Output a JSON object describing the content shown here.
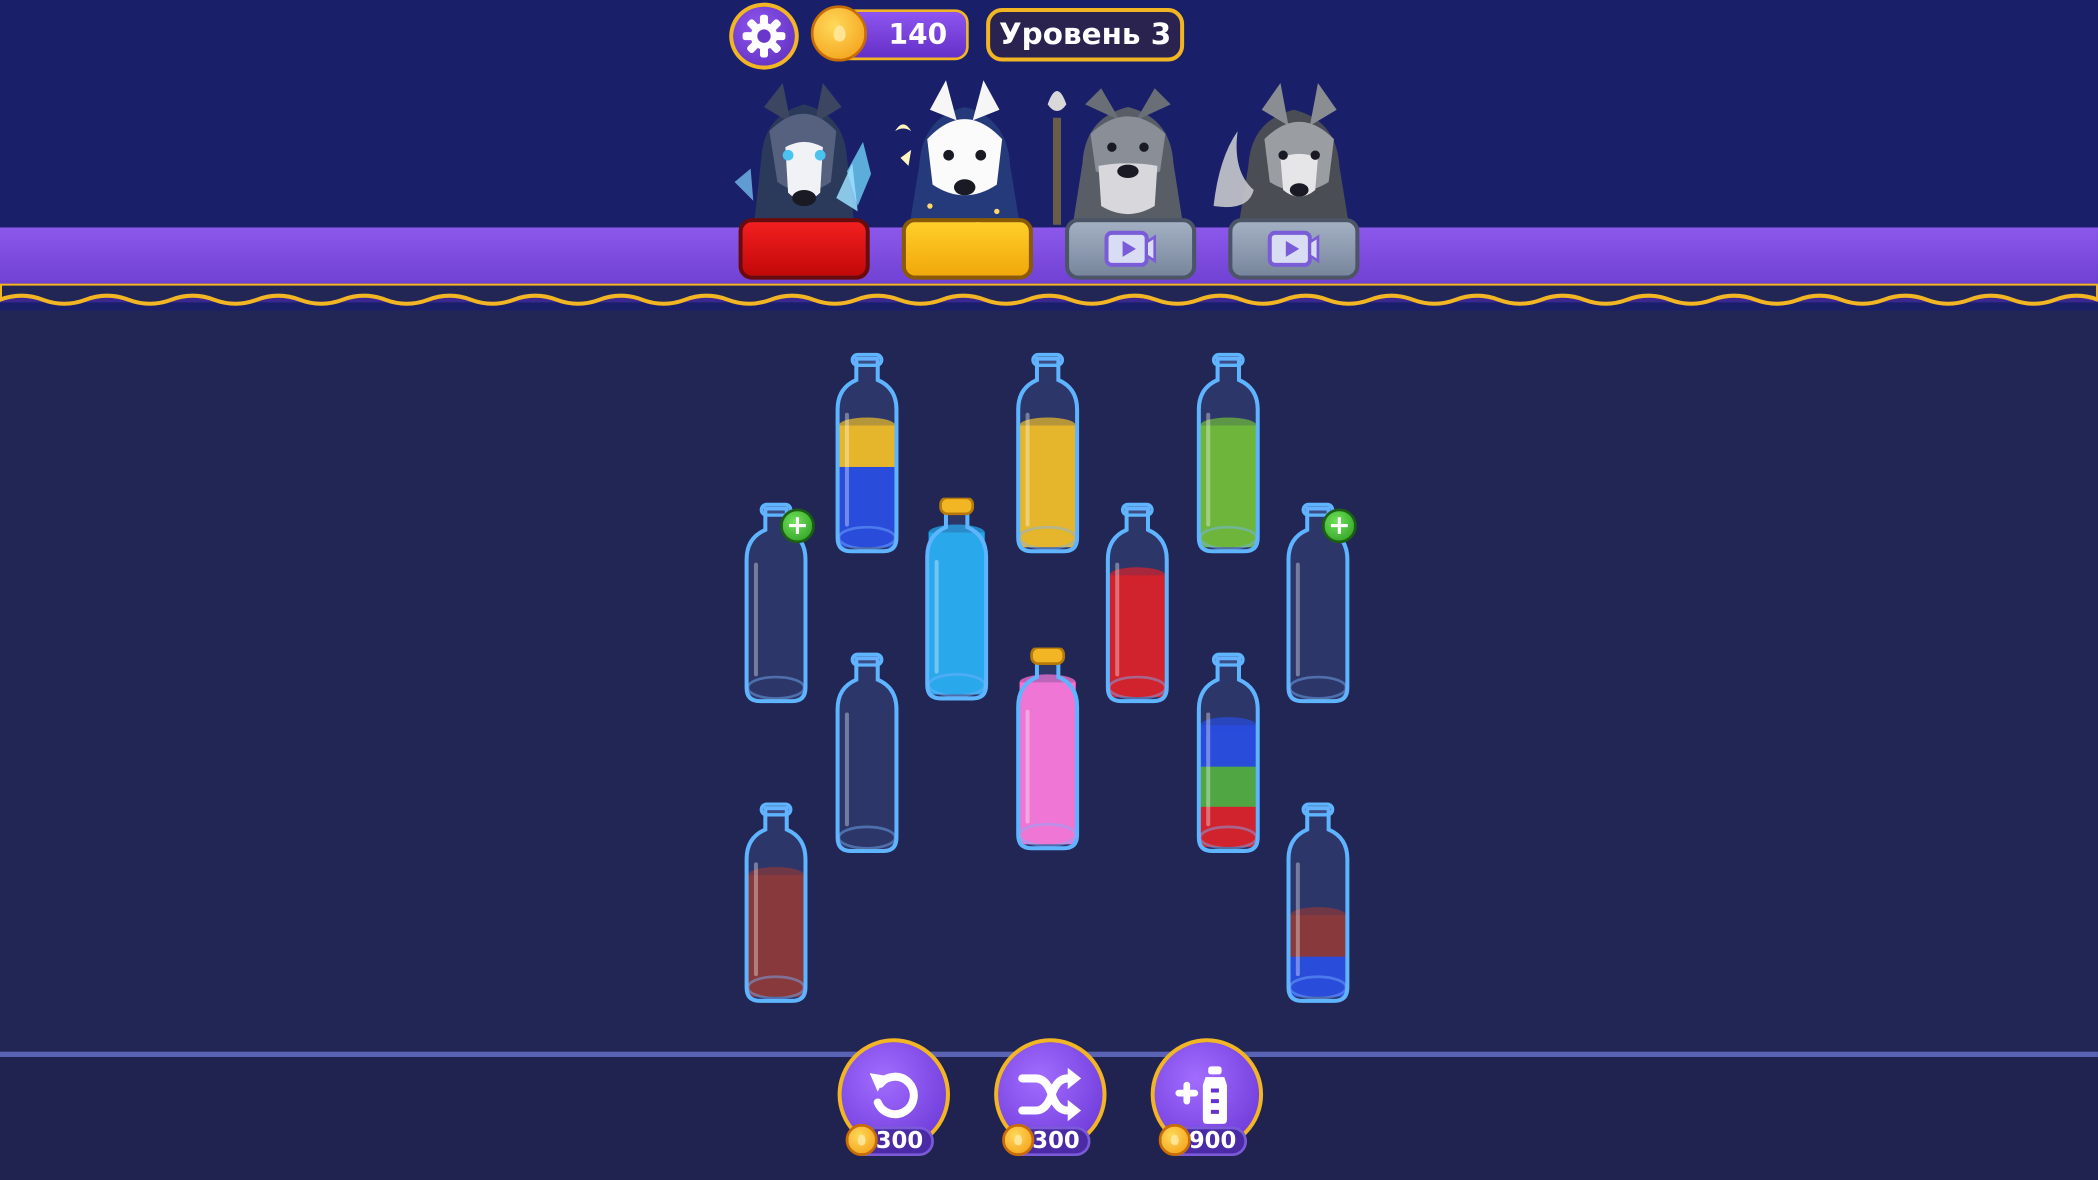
{
  "hud": {
    "coins": "140",
    "level": "Уровень 3",
    "settings_icon": "gear-icon",
    "coin_icon": "coin-drop-icon"
  },
  "characters": [
    {
      "name": "husky",
      "pedestal_color": "#e01414",
      "pedestal": "red",
      "locked": false
    },
    {
      "name": "samoyed",
      "pedestal_color": "#f7bb18",
      "pedestal": "yellow",
      "locked": false
    },
    {
      "name": "schnauzer",
      "pedestal": "gray",
      "locked": true,
      "icon": "video-play-icon"
    },
    {
      "name": "shiba",
      "pedestal": "gray",
      "locked": true,
      "icon": "video-play-icon"
    }
  ],
  "bottles": [
    {
      "id": "b1",
      "layers": [
        "#1e3fd6",
        "#1e3fd6",
        "#f4b80f"
      ],
      "capped": false
    },
    {
      "id": "b2",
      "layers": [
        "#f4b80f",
        "#f4b80f",
        "#f4b80f"
      ],
      "capped": false
    },
    {
      "id": "b3",
      "layers": [
        "#6bb820",
        "#6bb820",
        "#6bb820"
      ],
      "capped": false
    },
    {
      "id": "b4",
      "layers": [],
      "capped": false,
      "add_badge": true
    },
    {
      "id": "b5",
      "layers": [
        "#1fa8ea",
        "#1fa8ea",
        "#1fa8ea",
        "#1fa8ea"
      ],
      "capped": true
    },
    {
      "id": "b6",
      "layers": [
        "#dd1010",
        "#dd1010",
        "#dd1010"
      ],
      "capped": false
    },
    {
      "id": "b7",
      "layers": [],
      "capped": false,
      "add_badge": true
    },
    {
      "id": "b8",
      "layers": [],
      "capped": false
    },
    {
      "id": "b9",
      "layers": [
        "#ff6fd0",
        "#ff6fd0",
        "#ff6fd0",
        "#ff6fd0"
      ],
      "capped": true
    },
    {
      "id": "b10",
      "layers": [
        "#dd1010",
        "#4aa52a",
        "#1e3fd6"
      ],
      "capped": false
    },
    {
      "id": "b11",
      "layers": [
        "#8a2a22",
        "#8a2a22",
        "#8a2a22"
      ],
      "capped": false
    },
    {
      "id": "b12",
      "layers": [
        "#1e3fd6",
        "#8a2a22"
      ],
      "capped": false
    }
  ],
  "powerups": [
    {
      "name": "undo",
      "icon": "undo-icon",
      "price": "300"
    },
    {
      "name": "shuffle",
      "icon": "shuffle-icon",
      "price": "300"
    },
    {
      "name": "add-bottle",
      "icon": "add-bottle-icon",
      "price": "900"
    }
  ]
}
